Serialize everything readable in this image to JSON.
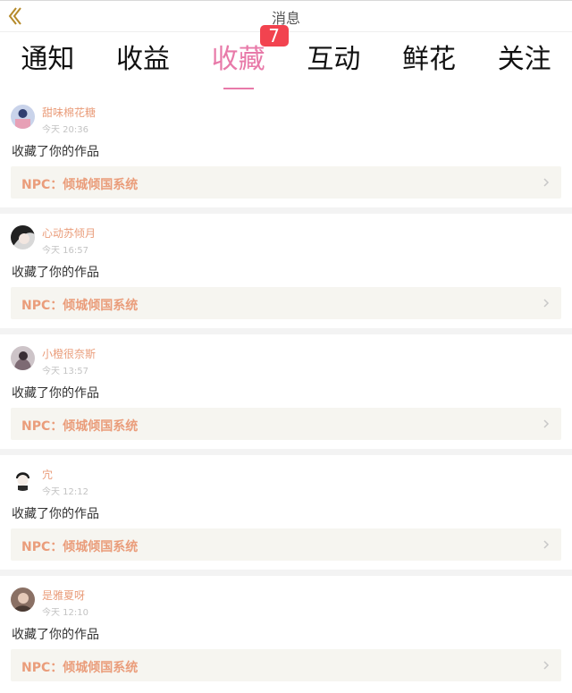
{
  "header": {
    "title": "消息"
  },
  "tabs": [
    {
      "label": "通知",
      "active": false
    },
    {
      "label": "收益",
      "active": false
    },
    {
      "label": "收藏",
      "active": true,
      "badge": "7"
    },
    {
      "label": "互动",
      "active": false
    },
    {
      "label": "鲜花",
      "active": false
    },
    {
      "label": "关注",
      "active": false
    }
  ],
  "colors": {
    "accent": "#e87aa9",
    "badge": "#f2434f",
    "username": "#ea9d7b",
    "card": "#f6f5f0"
  },
  "messages": [
    {
      "user": "甜味棉花糖",
      "time": "今天 20:36",
      "action": "收藏了你的作品",
      "work": "NPC：倾城倾国系统"
    },
    {
      "user": "心动苏倾月",
      "time": "今天 16:57",
      "action": "收藏了你的作品",
      "work": "NPC：倾城倾国系统"
    },
    {
      "user": "小橙很奈斯",
      "time": "今天 13:57",
      "action": "收藏了你的作品",
      "work": "NPC：倾城倾国系统"
    },
    {
      "user": "宂",
      "time": "今天 12:12",
      "action": "收藏了你的作品",
      "work": "NPC：倾城倾国系统"
    },
    {
      "user": "是雅夏呀",
      "time": "今天 12:10",
      "action": "收藏了你的作品",
      "work": "NPC：倾城倾国系统"
    }
  ]
}
